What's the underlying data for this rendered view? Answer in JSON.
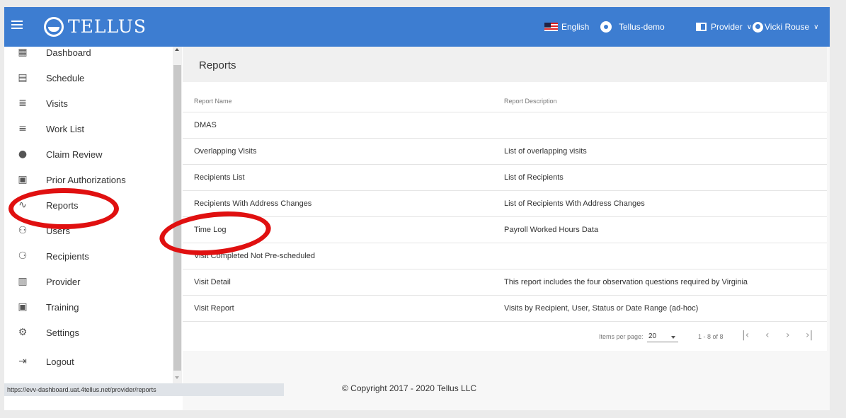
{
  "header": {
    "app_name": "TELLUS",
    "language": "English",
    "organization": "Tellus-demo",
    "role": "Provider",
    "user": "Vicki Rouse"
  },
  "sidebar": {
    "items": [
      {
        "label": "Dashboard",
        "icon": "dashboard-icon"
      },
      {
        "label": "Schedule",
        "icon": "calendar-icon"
      },
      {
        "label": "Visits",
        "icon": "filter-icon"
      },
      {
        "label": "Work List",
        "icon": "list-icon"
      },
      {
        "label": "Claim Review",
        "icon": "alert-icon"
      },
      {
        "label": "Prior Authorizations",
        "icon": "calendar-check-icon"
      },
      {
        "label": "Reports",
        "icon": "trending-icon"
      },
      {
        "label": "Users",
        "icon": "people-icon"
      },
      {
        "label": "Recipients",
        "icon": "people-outline-icon"
      },
      {
        "label": "Provider",
        "icon": "clipboard-icon"
      },
      {
        "label": "Training",
        "icon": "training-icon"
      },
      {
        "label": "Settings",
        "icon": "gear-icon"
      },
      {
        "label": "Logout",
        "icon": "logout-icon"
      }
    ]
  },
  "status_url": "https://evv-dashboard.uat.4tellus.net/provider/reports",
  "page": {
    "title": "Reports",
    "columns": {
      "name": "Report Name",
      "description": "Report Description"
    },
    "rows": [
      {
        "name": "DMAS",
        "description": ""
      },
      {
        "name": "Overlapping Visits",
        "description": "List of overlapping visits"
      },
      {
        "name": "Recipients List",
        "description": "List of Recipients"
      },
      {
        "name": "Recipients With Address Changes",
        "description": "List of Recipients With Address Changes"
      },
      {
        "name": "Time Log",
        "description": "Payroll Worked Hours Data"
      },
      {
        "name": "Visit Completed Not Pre-scheduled",
        "description": ""
      },
      {
        "name": "Visit Detail",
        "description": "This report includes the four observation questions required by Virginia"
      },
      {
        "name": "Visit Report",
        "description": "Visits by Recipient, User, Status or Date Range (ad-hoc)"
      }
    ],
    "paginator": {
      "items_per_page_label": "Items per page:",
      "items_per_page": "20",
      "range": "1 - 8 of 8"
    }
  },
  "footer": "© Copyright 2017 - 2020 Tellus LLC",
  "colors": {
    "topbar": "#3d7dd1",
    "highlight_ring": "#e01010"
  }
}
